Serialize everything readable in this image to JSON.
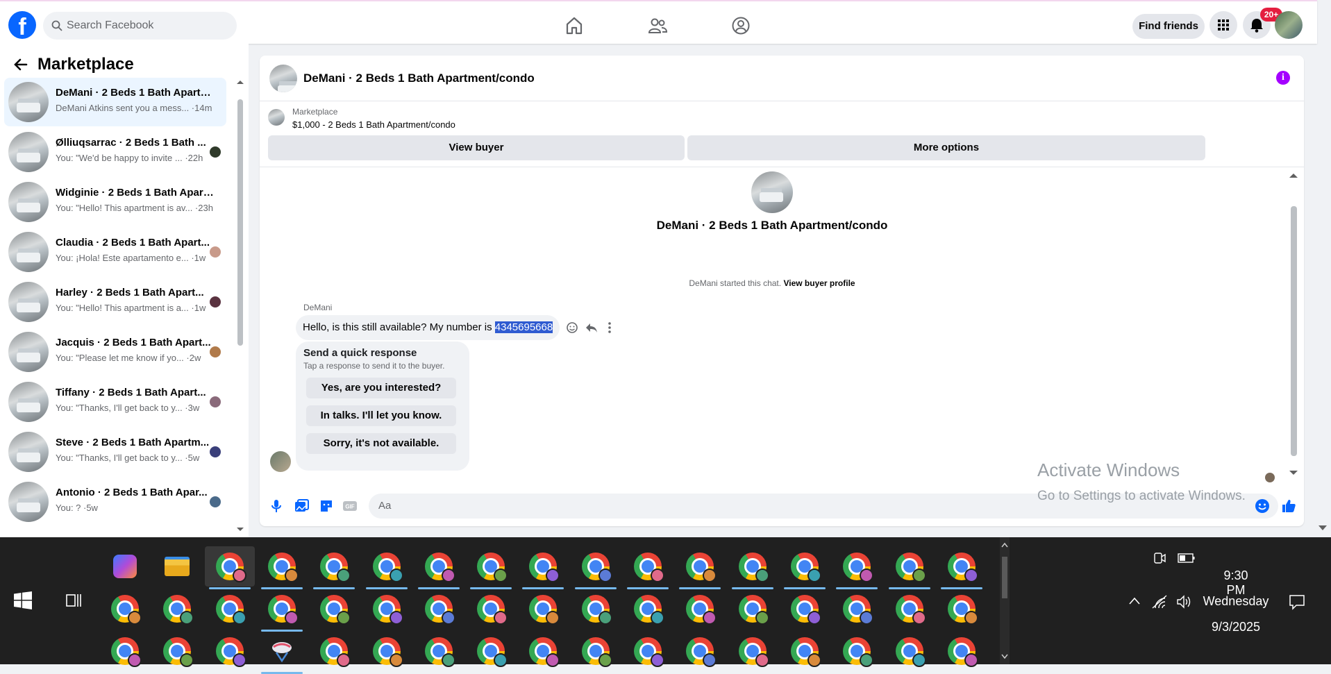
{
  "topbar": {
    "logo": "f",
    "search_placeholder": "Search Facebook",
    "find_friends": "Find friends",
    "notifications_badge": "20+",
    "nav_icons": [
      "home-icon",
      "friends-icon",
      "groups-icon"
    ]
  },
  "sidebar": {
    "title": "Marketplace",
    "conversations": [
      {
        "name": "DeMani · 2 Beds 1 Bath Apartm...",
        "preview": "DeMani Atkins sent you a mess... ·14m",
        "avatar_color": "",
        "active": true
      },
      {
        "name": "Ølliuqsarrac · 2 Beds 1 Bath ...",
        "preview": "You: \"We'd be happy to invite ... ·22h",
        "avatar_color": "#2f3a2a"
      },
      {
        "name": "Widginie · 2 Beds 1 Bath Apart...",
        "preview": "You: \"Hello! This apartment is av... ·23h",
        "avatar_color": ""
      },
      {
        "name": "Claudia · 2 Beds 1 Bath Apart...",
        "preview": "You: ¡Hola! Este apartamento e... ·1w",
        "avatar_color": "#c89a8a"
      },
      {
        "name": "Harley · 2 Beds 1 Bath Apart...",
        "preview": "You: \"Hello! This apartment is a... ·1w",
        "avatar_color": "#5a3340"
      },
      {
        "name": "Jacquis · 2 Beds 1 Bath Apart...",
        "preview": "You: \"Please let me know if yo... ·2w",
        "avatar_color": "#b07a4a"
      },
      {
        "name": "Tiffany · 2 Beds 1 Bath Apart...",
        "preview": "You: \"Thanks, I'll get back to y... ·3w",
        "avatar_color": "#8a6a7a"
      },
      {
        "name": "Steve · 2 Beds 1 Bath Apartm...",
        "preview": "You: \"Thanks, I'll get back to y... ·5w",
        "avatar_color": "#3a3f7a"
      },
      {
        "name": "Antonio · 2 Beds 1 Bath Apar...",
        "preview": "You: ? ·5w",
        "avatar_color": "#4a6a8a"
      }
    ]
  },
  "chat": {
    "title": "DeMani · 2 Beds 1 Bath Apartment/condo",
    "marketplace_label": "Marketplace",
    "listing": "$1,000 - 2 Beds 1 Bath Apartment/condo",
    "view_buyer": "View buyer",
    "more_options": "More options",
    "center_title": "DeMani · 2 Beds 1 Bath Apartment/condo",
    "started_text": "DeMani started this chat.",
    "view_buyer_profile": "View buyer profile",
    "sender": "DeMani",
    "message_prefix": "Hello, is this still available? My number is ",
    "message_number": "4345695668",
    "quick_title": "Send a quick response",
    "quick_sub": "Tap a response to send it to the buyer.",
    "quick_responses": [
      "Yes, are you interested?",
      "In talks. I'll let you know.",
      "Sorry, it's not available."
    ],
    "composer_placeholder": "Aa"
  },
  "watermark": {
    "line1": "Activate Windows",
    "line2": "Go to Settings to activate Windows."
  },
  "taskbar": {
    "time": "9:30 PM",
    "day": "Wednesday",
    "date": "9/3/2025"
  },
  "colors": {
    "brand": "#0866ff",
    "badge": "#e41e3f",
    "info": "#a400ff",
    "selection": "#2f5bd1"
  }
}
